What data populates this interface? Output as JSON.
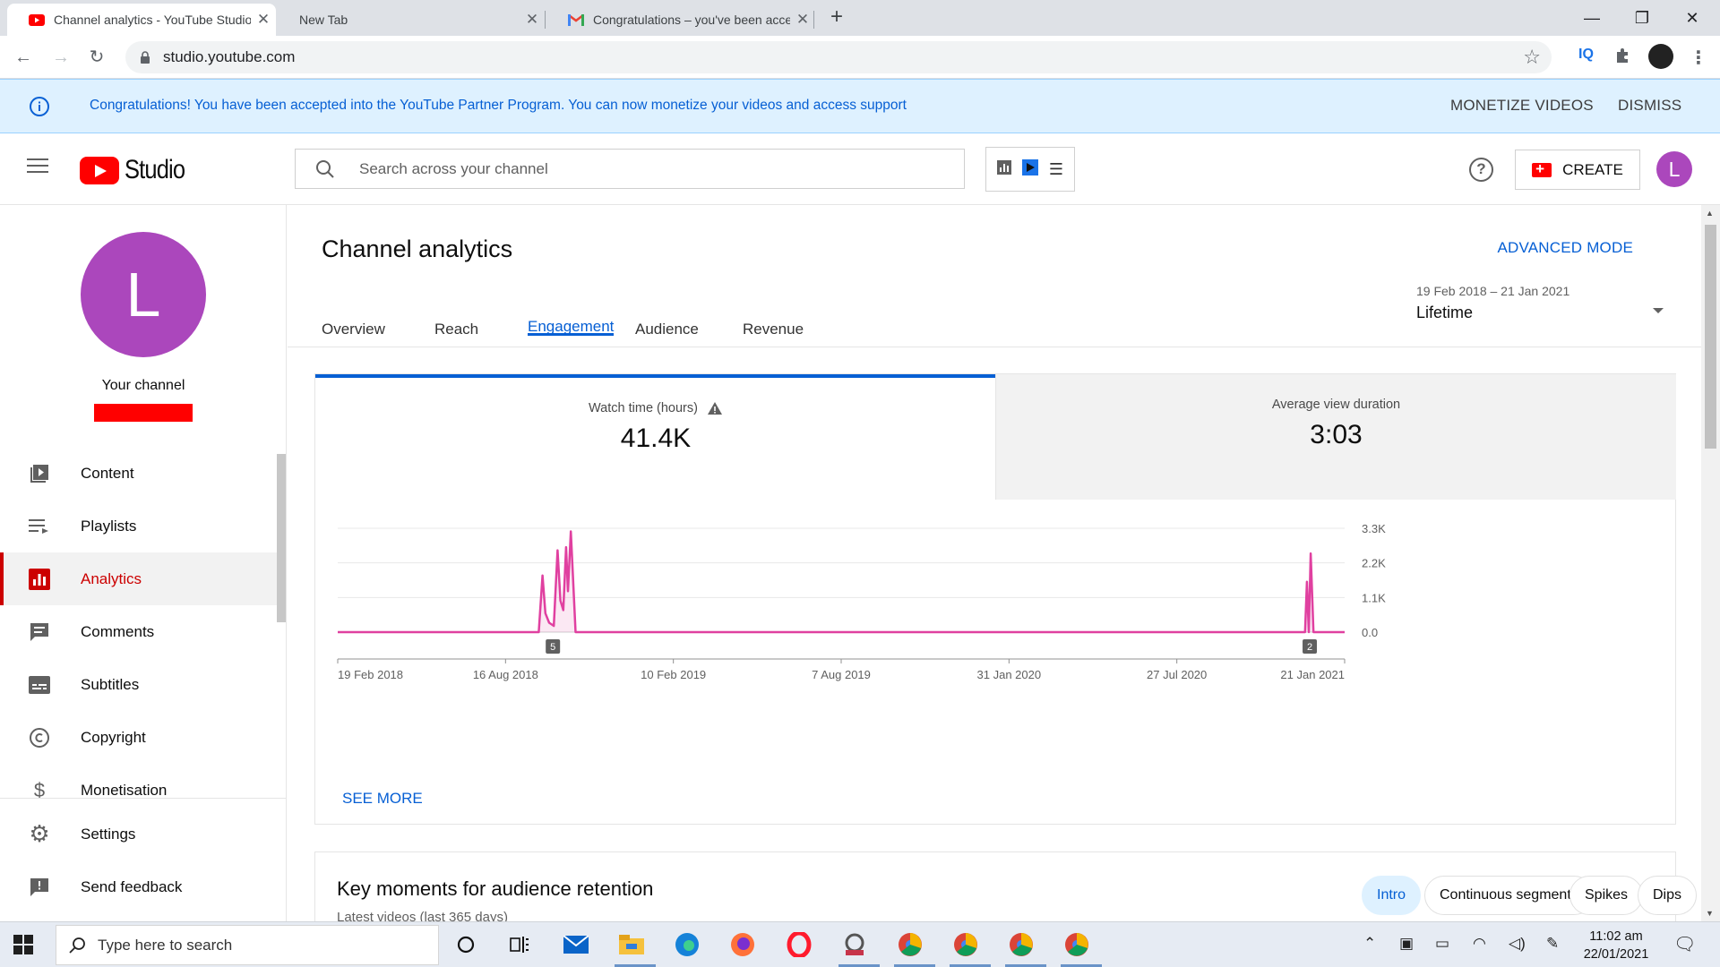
{
  "browser": {
    "tabs": [
      {
        "title": "Channel analytics - YouTube Studio",
        "favicon": "youtube-icon"
      },
      {
        "title": "New Tab",
        "favicon": ""
      },
      {
        "title": "Congratulations – you've been accepted",
        "favicon": "gmail-icon"
      }
    ],
    "url": "studio.youtube.com"
  },
  "banner": {
    "message": "Congratulations! You have been accepted into the YouTube Partner Program. You can now monetize your videos and access support",
    "monetize_label": "MONETIZE VIDEOS",
    "dismiss_label": "DISMISS",
    "color": "#def1ff"
  },
  "header": {
    "logo_text": "Studio",
    "search_placeholder": "Search across your channel",
    "create_label": "CREATE",
    "avatar_letter": "L"
  },
  "sidebar": {
    "avatar_letter": "L",
    "channel_label": "Your channel",
    "items": [
      {
        "label": "Content",
        "icon": "content-icon"
      },
      {
        "label": "Playlists",
        "icon": "playlists-icon"
      },
      {
        "label": "Analytics",
        "icon": "analytics-icon",
        "active": true
      },
      {
        "label": "Comments",
        "icon": "comments-icon"
      },
      {
        "label": "Subtitles",
        "icon": "subtitles-icon"
      },
      {
        "label": "Copyright",
        "icon": "copyright-icon"
      },
      {
        "label": "Monetisation",
        "icon": "monetisation-icon"
      }
    ],
    "bottom_items": [
      {
        "label": "Settings",
        "icon": "settings-icon"
      },
      {
        "label": "Send feedback",
        "icon": "feedback-icon"
      }
    ]
  },
  "main": {
    "title": "Channel analytics",
    "advanced_mode": "ADVANCED MODE",
    "tabs": [
      "Overview",
      "Reach",
      "Engagement",
      "Audience",
      "Revenue"
    ],
    "active_tab": "Engagement",
    "date_range": "19 Feb 2018 – 21 Jan 2021",
    "date_preset": "Lifetime",
    "metrics": [
      {
        "label": "Watch time (hours)",
        "value": "41.4K",
        "warning": true
      },
      {
        "label": "Average view duration",
        "value": "3:03"
      }
    ],
    "see_more": "SEE MORE",
    "key_moments": {
      "title": "Key moments for audience retention",
      "subtitle": "Latest videos (last 365 days)",
      "chips": [
        "Intro",
        "Continuous segments",
        "Spikes",
        "Dips"
      ],
      "active_chip": "Intro"
    }
  },
  "chart_data": {
    "type": "line",
    "series_color": "#e040a0",
    "y_ticks": [
      "3.3K",
      "2.2K",
      "1.1K",
      "0.0"
    ],
    "ylim": [
      0,
      3300
    ],
    "x_ticks": [
      "19 Feb 2018",
      "16 Aug 2018",
      "10 Feb 2019",
      "7 Aug 2019",
      "31 Jan 2020",
      "27 Jul 2020",
      "21 Jan 2021"
    ],
    "xlim": [
      "2018-02-19",
      "2021-01-21"
    ],
    "points": [
      [
        "2018-02-19",
        0
      ],
      [
        "2018-09-20",
        0
      ],
      [
        "2018-09-24",
        1800
      ],
      [
        "2018-09-27",
        600
      ],
      [
        "2018-10-01",
        300
      ],
      [
        "2018-10-06",
        200
      ],
      [
        "2018-10-10",
        2600
      ],
      [
        "2018-10-13",
        1000
      ],
      [
        "2018-10-16",
        700
      ],
      [
        "2018-10-19",
        2700
      ],
      [
        "2018-10-21",
        1300
      ],
      [
        "2018-10-24",
        3200
      ],
      [
        "2018-10-29",
        0
      ],
      [
        "2020-12-10",
        0
      ],
      [
        "2020-12-12",
        1600
      ],
      [
        "2020-12-14",
        0
      ],
      [
        "2020-12-16",
        2500
      ],
      [
        "2020-12-19",
        0
      ],
      [
        "2021-01-21",
        0
      ]
    ],
    "markers": [
      {
        "label": "5",
        "date": "2018-10-05"
      },
      {
        "label": "2",
        "date": "2020-12-15"
      }
    ]
  },
  "taskbar": {
    "search_placeholder": "Type here to search",
    "time": "11:02 am",
    "date": "22/01/2021"
  }
}
